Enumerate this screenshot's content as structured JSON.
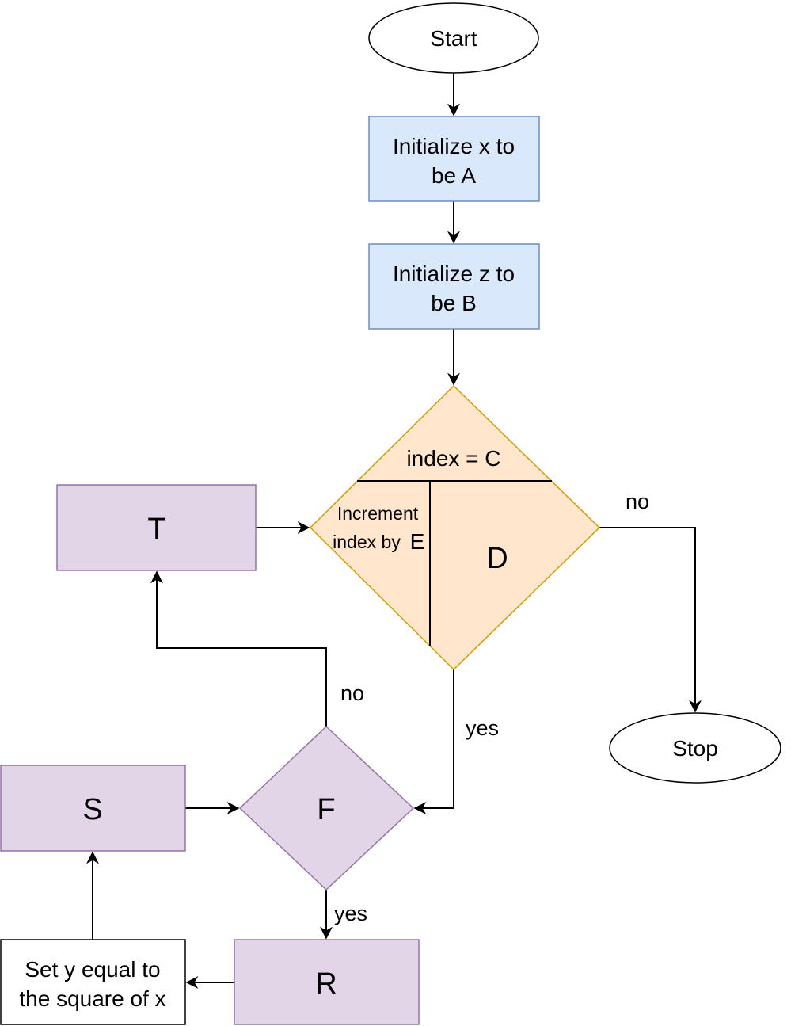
{
  "colors": {
    "process_fill": "#dae8fc",
    "process_stroke": "#6c8ebf",
    "decision_fill": "#ffe6cc",
    "decision_stroke": "#d79b00",
    "purple_fill": "#e1d5e7",
    "purple_stroke": "#9673a6"
  },
  "nodes": {
    "start": "Start",
    "init_x": [
      "Initialize x to",
      "be A"
    ],
    "init_z": [
      "Initialize z to",
      "be B"
    ],
    "loop_condition": "index = C",
    "loop_increment": [
      "Increment",
      "index by",
      "E"
    ],
    "loop_body": "D",
    "t": "T",
    "stop": "Stop",
    "f": "F",
    "s": "S",
    "r": "R",
    "set_y": [
      "Set y equal to",
      "the square of x"
    ]
  },
  "edge_labels": {
    "d_no": "no",
    "d_yes": "yes",
    "f_no": "no",
    "f_yes": "yes"
  }
}
